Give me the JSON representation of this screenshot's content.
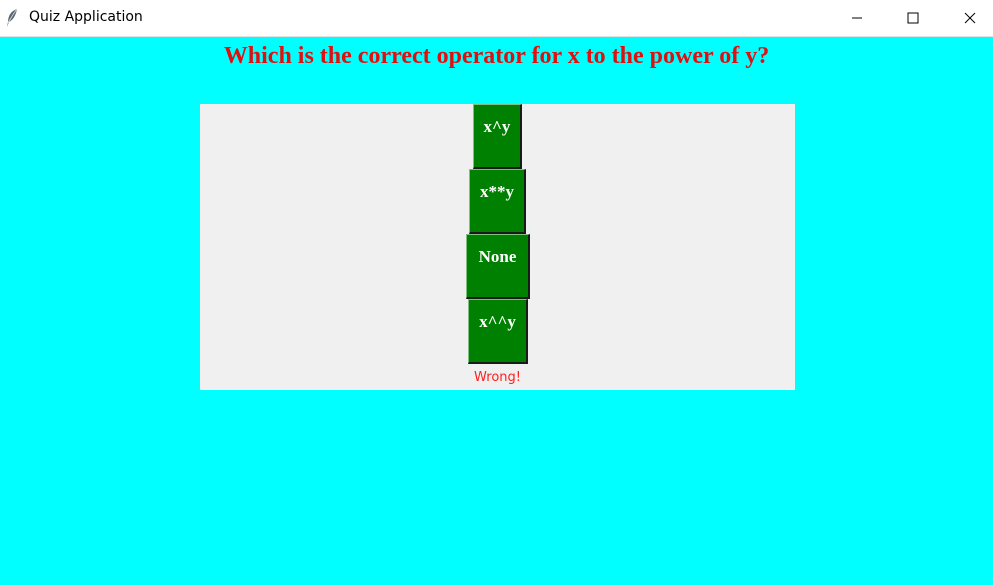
{
  "window": {
    "title": "Quiz Application",
    "icon": "feather-icon",
    "controls": [
      "minimize-icon",
      "maximize-icon",
      "close-icon"
    ]
  },
  "quiz": {
    "question": "Which is the correct operator for x to the power of y?",
    "options": [
      "x^y",
      "x**y",
      "None",
      "x^^y"
    ],
    "feedback": "Wrong!"
  },
  "colors": {
    "background": "#00ffff",
    "question_text": "#e01010",
    "panel": "#f0f0f0",
    "option_button": "#008000",
    "option_text": "#ffffff",
    "feedback_text": "#ff2020"
  }
}
